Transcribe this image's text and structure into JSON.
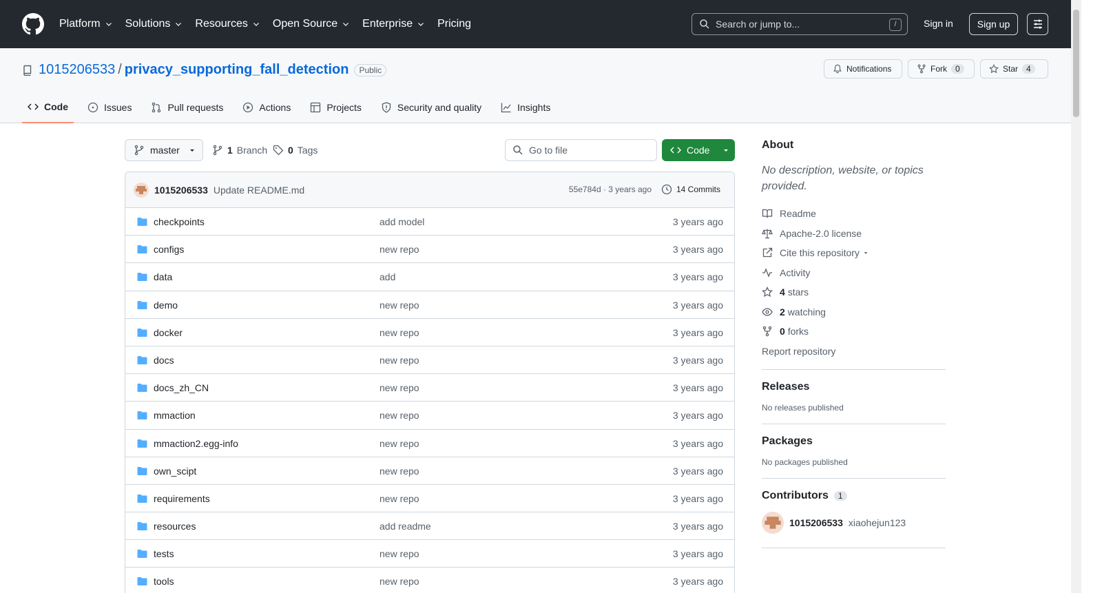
{
  "header": {
    "nav": [
      {
        "label": "Platform"
      },
      {
        "label": "Solutions"
      },
      {
        "label": "Resources"
      },
      {
        "label": "Open Source"
      },
      {
        "label": "Enterprise"
      },
      {
        "label": "Pricing"
      }
    ],
    "search_placeholder": "Search or jump to...",
    "search_shortcut": "/",
    "signin": "Sign in",
    "signup": "Sign up"
  },
  "repo": {
    "owner": "1015206533",
    "separator": "/",
    "name": "privacy_supporting_fall_detection",
    "visibility": "Public",
    "notifications_label": "Notifications",
    "fork_label": "Fork",
    "fork_count": "0",
    "star_label": "Star",
    "star_count": "4"
  },
  "tabs": [
    {
      "label": "Code"
    },
    {
      "label": "Issues"
    },
    {
      "label": "Pull requests"
    },
    {
      "label": "Actions"
    },
    {
      "label": "Projects"
    },
    {
      "label": "Security and quality"
    },
    {
      "label": "Insights"
    }
  ],
  "toolbar": {
    "branch": "master",
    "branch_count": "1",
    "branch_label": "Branch",
    "tag_count": "0",
    "tag_label": "Tags",
    "goto_placeholder": "Go to file",
    "code_label": "Code"
  },
  "commit": {
    "author": "1015206533",
    "message": "Update README.md",
    "hash_time": "55e784d · 3 years ago",
    "count": "14 Commits"
  },
  "files": [
    {
      "name": "checkpoints",
      "message": "add model",
      "date": "3 years ago"
    },
    {
      "name": "configs",
      "message": "new repo",
      "date": "3 years ago"
    },
    {
      "name": "data",
      "message": "add",
      "date": "3 years ago"
    },
    {
      "name": "demo",
      "message": "new repo",
      "date": "3 years ago"
    },
    {
      "name": "docker",
      "message": "new repo",
      "date": "3 years ago"
    },
    {
      "name": "docs",
      "message": "new repo",
      "date": "3 years ago"
    },
    {
      "name": "docs_zh_CN",
      "message": "new repo",
      "date": "3 years ago"
    },
    {
      "name": "mmaction",
      "message": "new repo",
      "date": "3 years ago"
    },
    {
      "name": "mmaction2.egg-info",
      "message": "new repo",
      "date": "3 years ago"
    },
    {
      "name": "own_scipt",
      "message": "new repo",
      "date": "3 years ago"
    },
    {
      "name": "requirements",
      "message": "new repo",
      "date": "3 years ago"
    },
    {
      "name": "resources",
      "message": "add readme",
      "date": "3 years ago"
    },
    {
      "name": "tests",
      "message": "new repo",
      "date": "3 years ago"
    },
    {
      "name": "tools",
      "message": "new repo",
      "date": "3 years ago"
    }
  ],
  "sidebar": {
    "about_title": "About",
    "description": "No description, website, or topics provided.",
    "readme": "Readme",
    "license": "Apache-2.0 license",
    "cite": "Cite this repository",
    "activity": "Activity",
    "stars_count": "4",
    "stars_label": "stars",
    "watching_count": "2",
    "watching_label": "watching",
    "forks_count": "0",
    "forks_label": "forks",
    "report": "Report repository",
    "releases_title": "Releases",
    "releases_empty": "No releases published",
    "packages_title": "Packages",
    "packages_empty": "No packages published",
    "contributors_title": "Contributors",
    "contributors_count": "1",
    "contributor_login": "1015206533",
    "contributor_name": "xiaohejun123"
  },
  "colors": {
    "header_bg": "#24292f",
    "link": "#0969da",
    "primary_button": "#1f883d",
    "active_tab_underline": "#fd8c73",
    "folder": "#54aeff"
  }
}
